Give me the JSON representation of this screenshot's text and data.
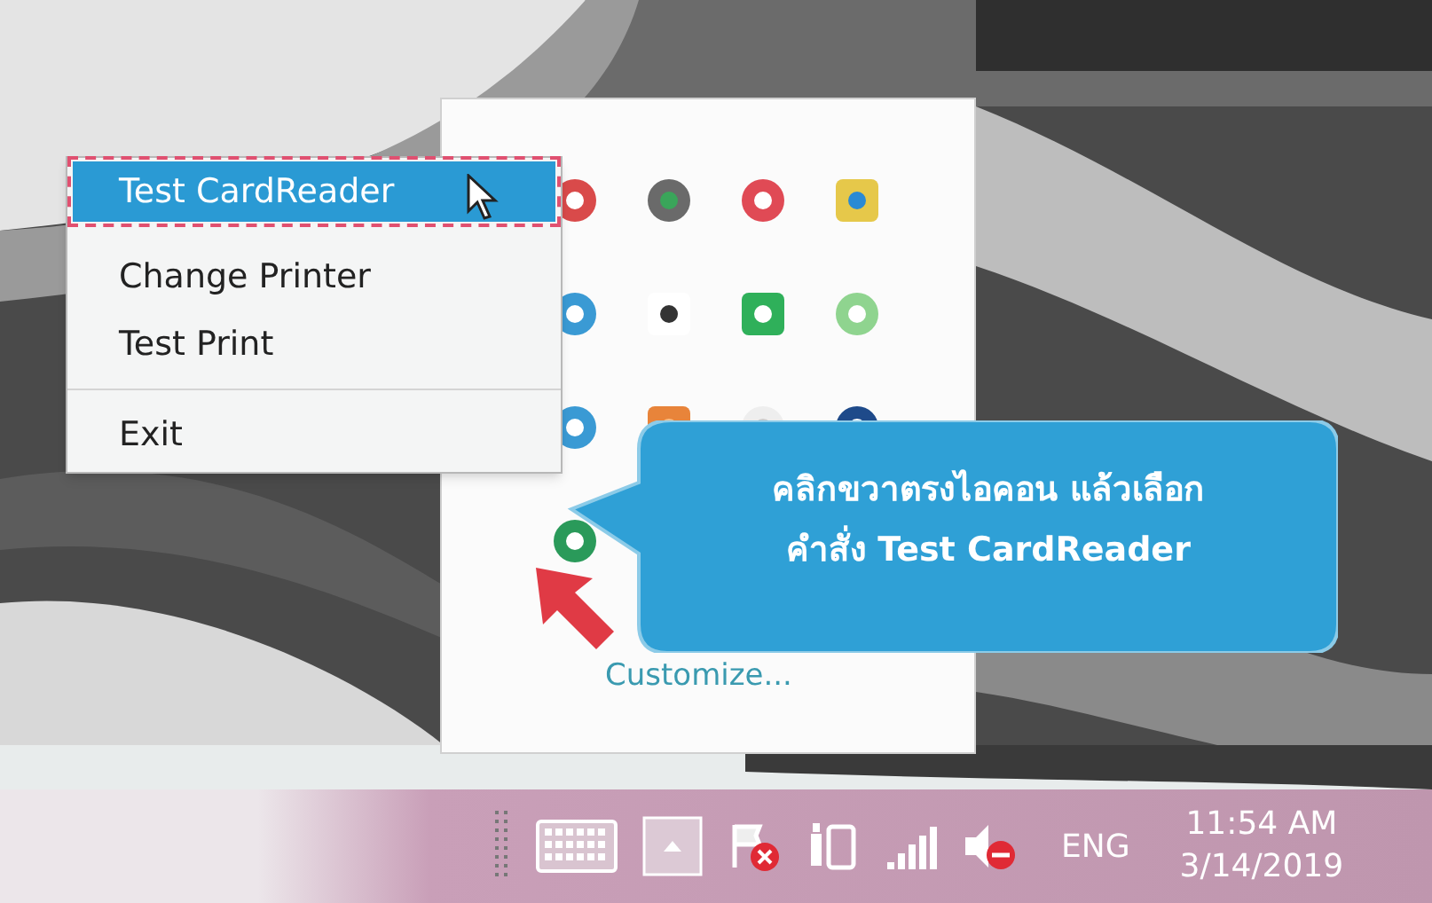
{
  "context_menu": {
    "groups": [
      [
        {
          "label": "Test CardReader",
          "selected": true
        },
        {
          "label": "Change Printer",
          "selected": false
        },
        {
          "label": "Test Print",
          "selected": false
        }
      ],
      [
        {
          "label": "Exit",
          "selected": false
        }
      ]
    ]
  },
  "tray_flyout": {
    "link": "Customize..."
  },
  "callout": {
    "lines": [
      "คลิกขวาตรงไอคอน แล้วเลือก",
      "คำสั่ง Test CardReader"
    ]
  },
  "taskbar": {
    "language": "ENG",
    "time": "11:54 AM",
    "date": "3/14/2019"
  }
}
